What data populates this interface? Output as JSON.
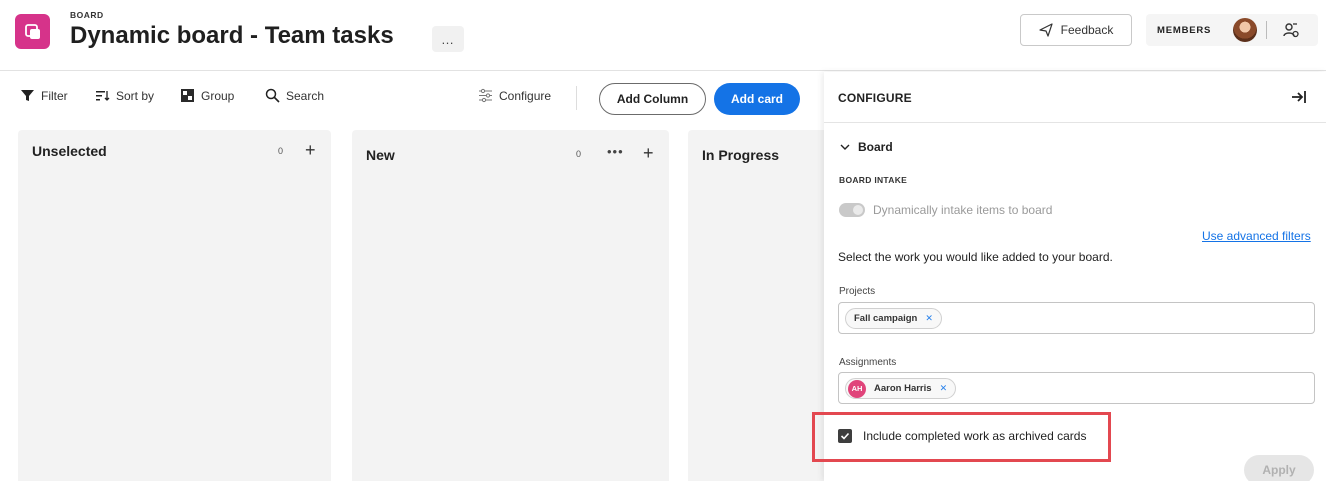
{
  "header": {
    "kicker": "BOARD",
    "title": "Dynamic board - Team tasks",
    "more_label": "…",
    "feedback_label": "Feedback",
    "members_label": "MEMBERS",
    "app_color": "#d6338a"
  },
  "toolbar": {
    "filter": "Filter",
    "sort": "Sort by",
    "group": "Group",
    "search": "Search",
    "configure": "Configure",
    "add_column": "Add Column",
    "add_card": "Add card",
    "accent": "#1473e6"
  },
  "columns": [
    {
      "title": "Unselected",
      "count": "0"
    },
    {
      "title": "New",
      "count": "0"
    },
    {
      "title": "In Progress"
    }
  ],
  "panel": {
    "title": "CONFIGURE",
    "section": "Board",
    "intake_label": "BOARD INTAKE",
    "toggle_label": "Dynamically intake items to board",
    "toggle_on": false,
    "advanced_link": "Use advanced filters",
    "instruction": "Select the work you would like added to your board.",
    "projects_label": "Projects",
    "projects": [
      {
        "name": "Fall campaign"
      }
    ],
    "assignments_label": "Assignments",
    "assignments": [
      {
        "initials": "AH",
        "name": "Aaron Harris"
      }
    ],
    "include_completed_label": "Include completed work as archived cards",
    "include_completed_checked": true,
    "apply_label": "Apply",
    "highlight_color": "#e34850"
  }
}
